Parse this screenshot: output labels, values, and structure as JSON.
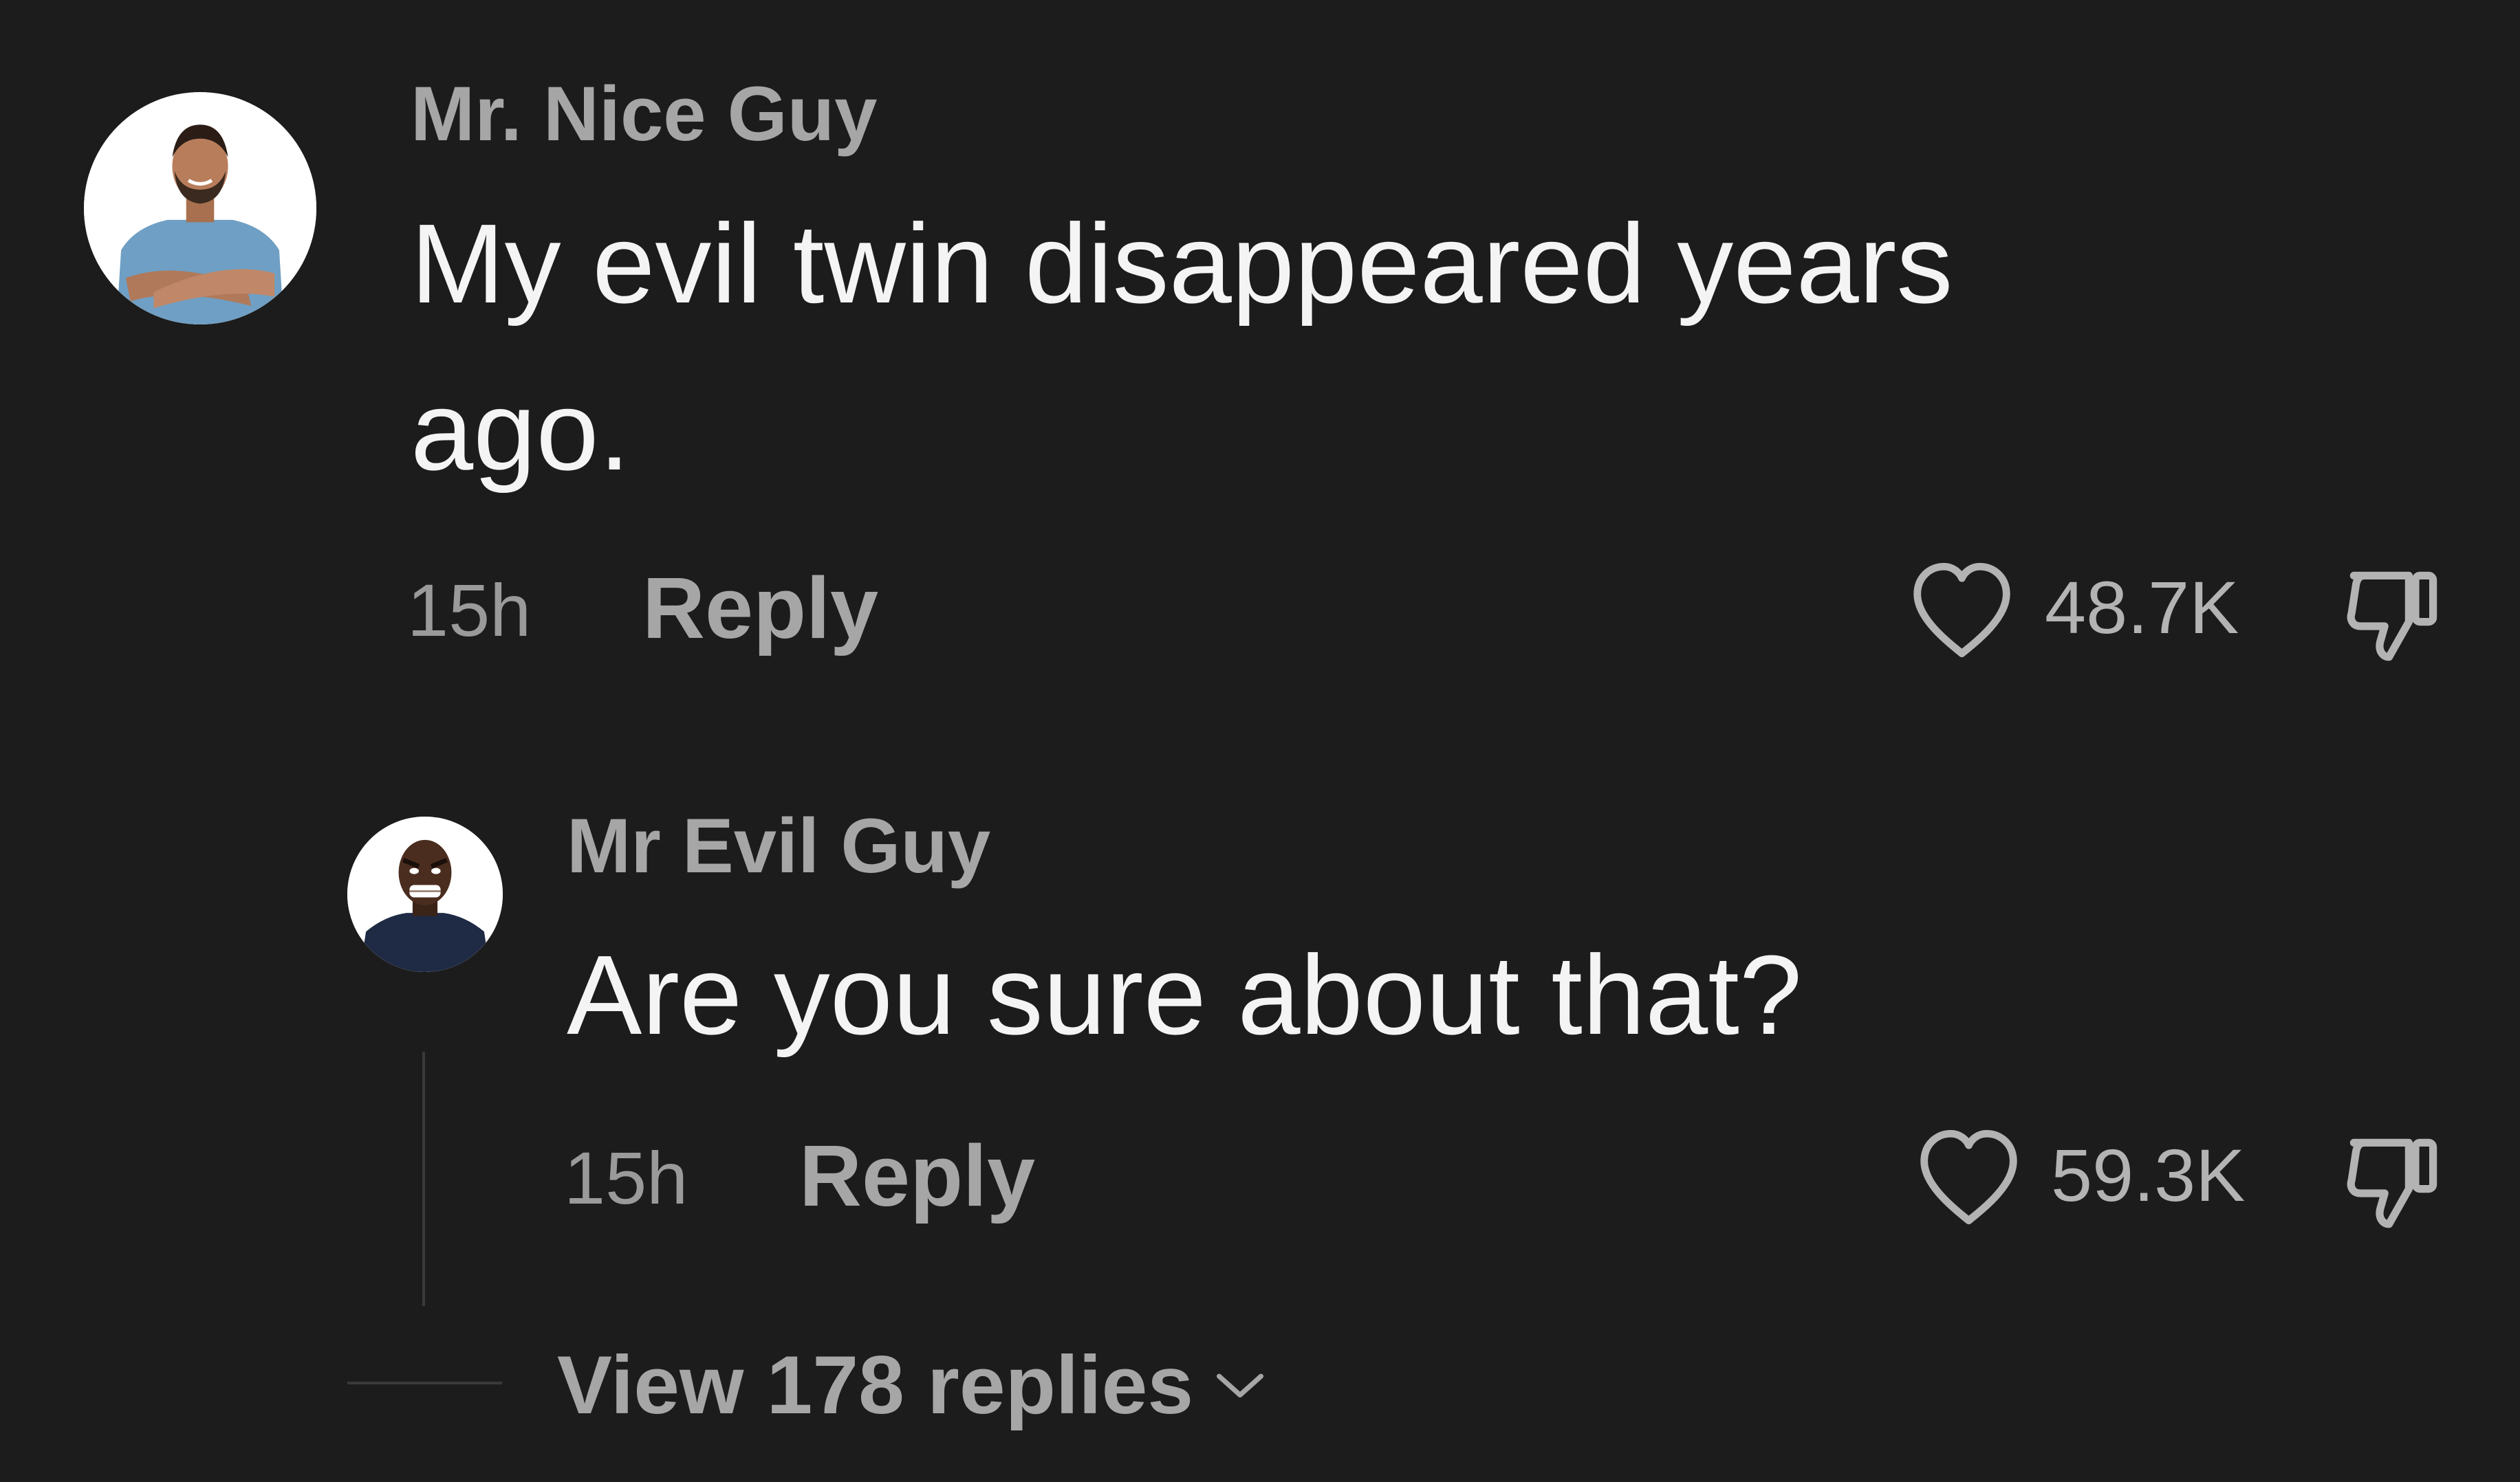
{
  "comments": [
    {
      "username": "Mr. Nice Guy",
      "text_line1": "My evil twin disappeared years",
      "text_line2": "ago.",
      "time": "15h",
      "reply_label": "Reply",
      "likes": "48.7K"
    },
    {
      "username": "Mr Evil Guy",
      "text_line1": "Are you sure about that?",
      "time": "15h",
      "reply_label": "Reply",
      "likes": "59.3K"
    }
  ],
  "view_replies_label": "View 178 replies",
  "icons": {
    "like": "heart-outline-icon",
    "dislike": "thumbs-down-outline-icon",
    "expand": "chevron-down-icon"
  },
  "colors": {
    "background": "#1c1c1c",
    "primary_text": "#f4f4f4",
    "secondary_text": "#a6a6a6"
  }
}
